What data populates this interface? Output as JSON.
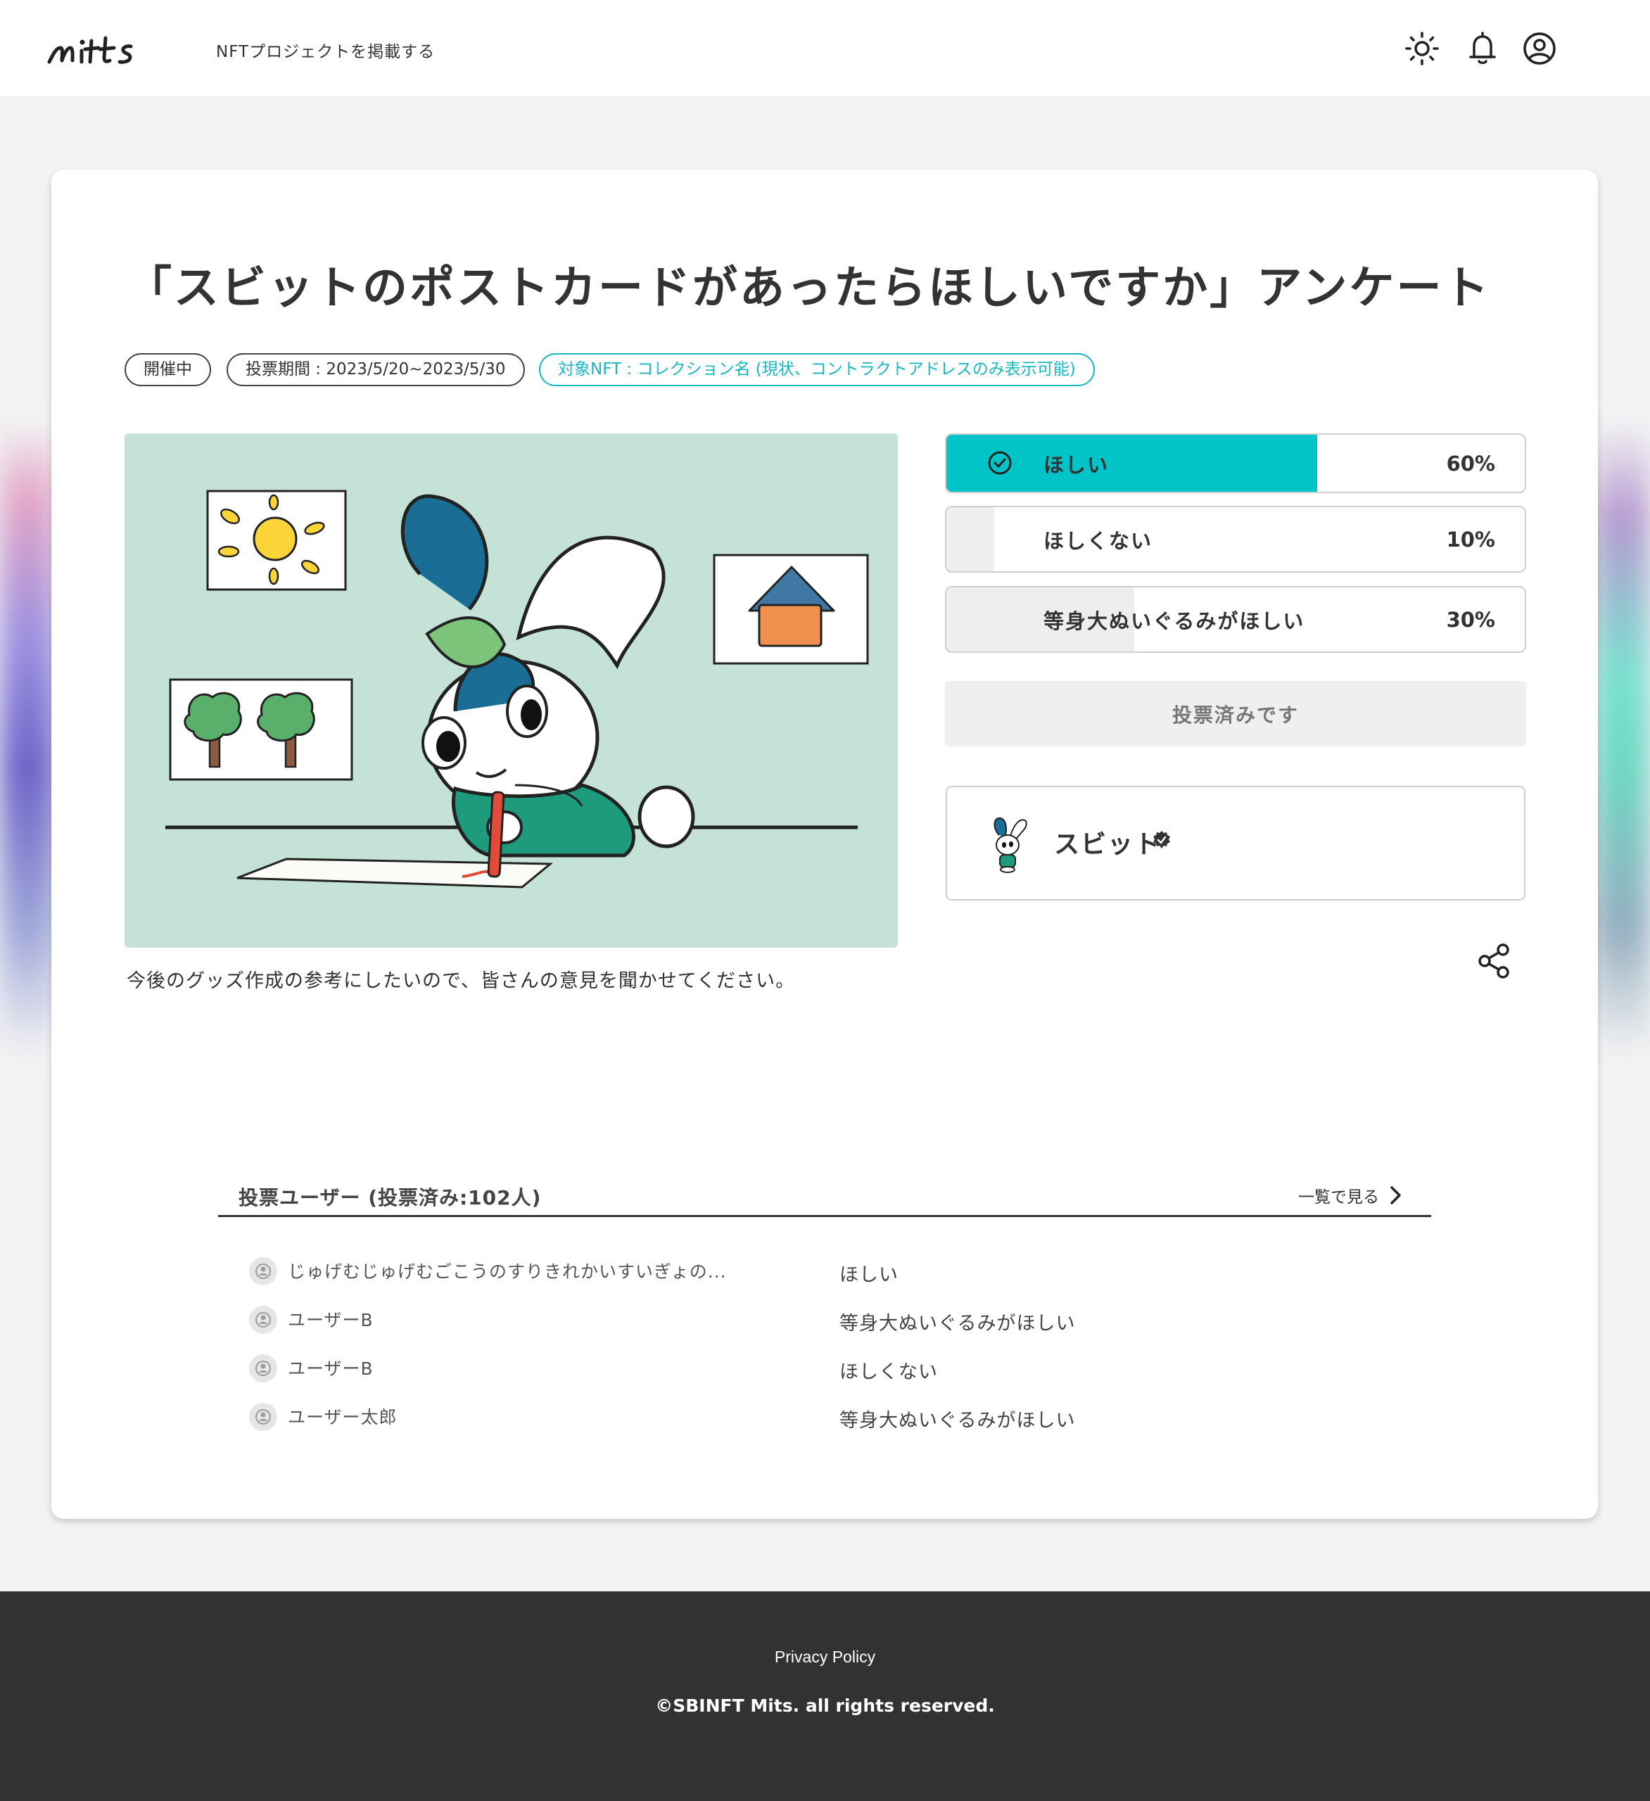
{
  "header": {
    "nav_link": "NFTプロジェクトを掲載する",
    "icons": [
      "logo-mits",
      "sun-icon",
      "bell-icon",
      "user-circle-icon"
    ]
  },
  "poll": {
    "title": "「スビットのポストカードがあったらほしいですか」アンケート",
    "tags": {
      "status": "開催中",
      "period": "投票期間 : 2023/5/20~2023/5/30",
      "target": "対象NFT : コレクション名 (現状、コントラクトアドレスのみ表示可能)"
    },
    "description": "今後のグッズ作成の参考にしたいので、皆さんの意見を聞かせてください。",
    "options": [
      {
        "label": "ほしい",
        "percent": "60%",
        "value": 60,
        "selected": true
      },
      {
        "label": "ほしくない",
        "percent": "10%",
        "value": 10,
        "selected": false
      },
      {
        "label": "等身大ぬいぐるみがほしい",
        "percent": "30%",
        "value": 30,
        "selected": false
      }
    ],
    "voted_label": "投票済みです",
    "creator_name": "スビット",
    "accent_color": "#00c4c8"
  },
  "voters": {
    "title": "投票ユーザー (投票済み:102人)",
    "see_all": "一覧で見る",
    "rows": [
      {
        "name": "じゅげむじゅげむごこうのすりきれかいすいぎょの...",
        "choice": "ほしい"
      },
      {
        "name": "ユーザーB",
        "choice": "等身大ぬいぐるみがほしい"
      },
      {
        "name": "ユーザーB",
        "choice": "ほしくない"
      },
      {
        "name": "ユーザー太郎",
        "choice": "等身大ぬいぐるみがほしい"
      }
    ]
  },
  "footer": {
    "privacy": "Privacy Policy",
    "copyright": "©SBINFT Mits. all rights reserved."
  }
}
